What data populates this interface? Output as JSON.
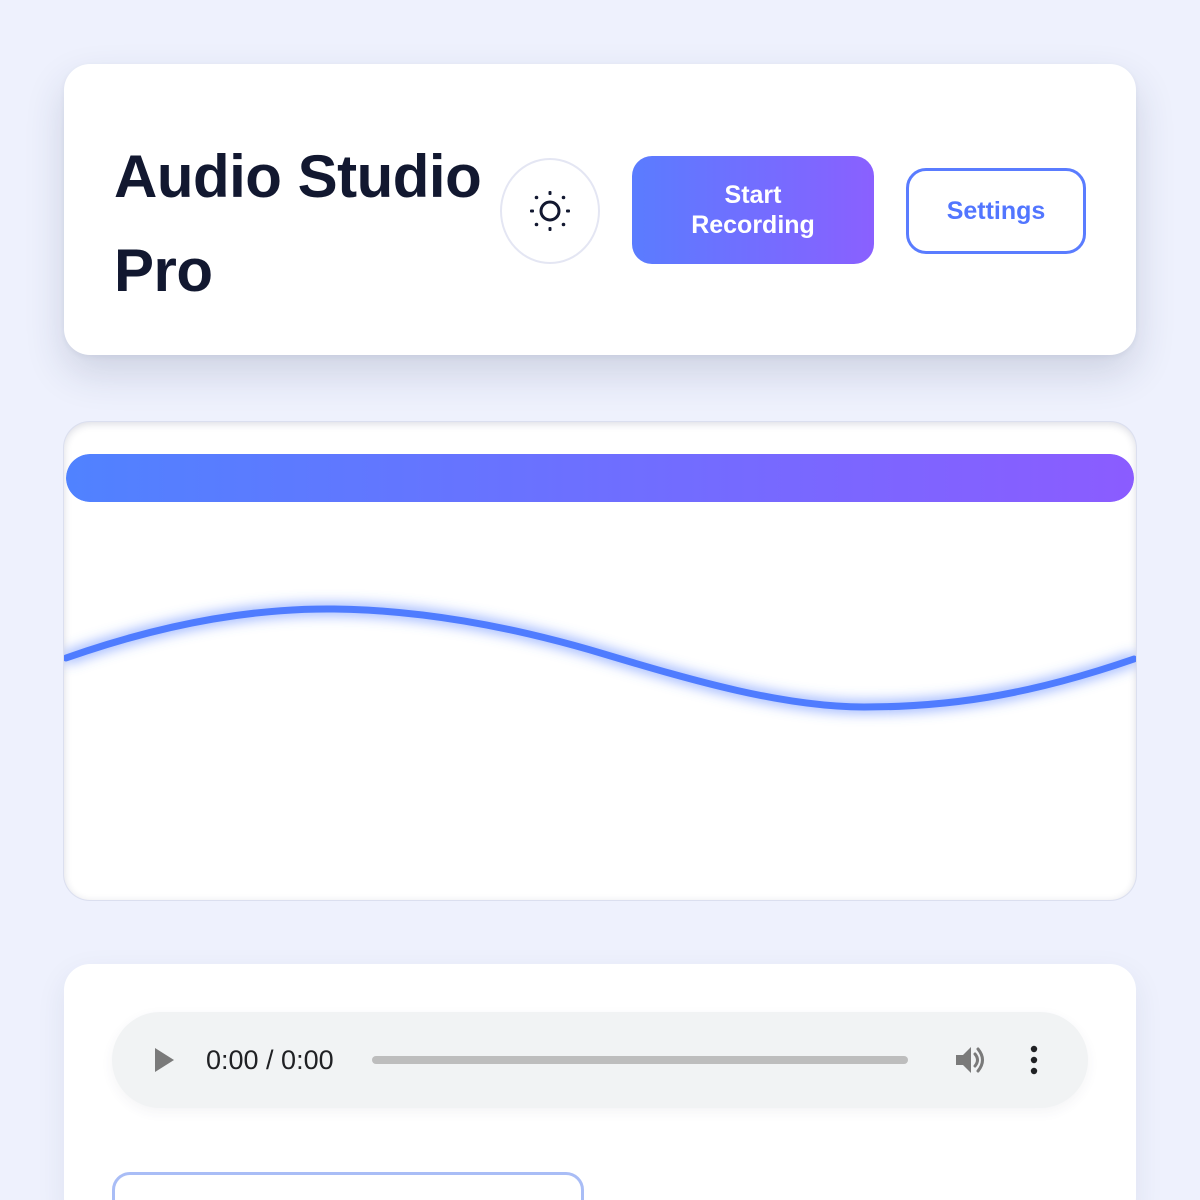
{
  "header": {
    "title": "Audio Studio Pro",
    "theme_icon": "sun-icon",
    "record_label": "Start Recording",
    "settings_label": "Settings"
  },
  "visualizer": {
    "level_percent": 100,
    "wave_color": "#4f7cff"
  },
  "player": {
    "time": "0:00 / 0:00",
    "progress_percent": 0,
    "icons": [
      "play-icon",
      "volume-icon",
      "more-vert-icon"
    ]
  },
  "filename": {
    "value": ""
  },
  "colors": {
    "accent_start": "#5a7cff",
    "accent_end": "#8a60ff",
    "background": "#eef1fd"
  }
}
